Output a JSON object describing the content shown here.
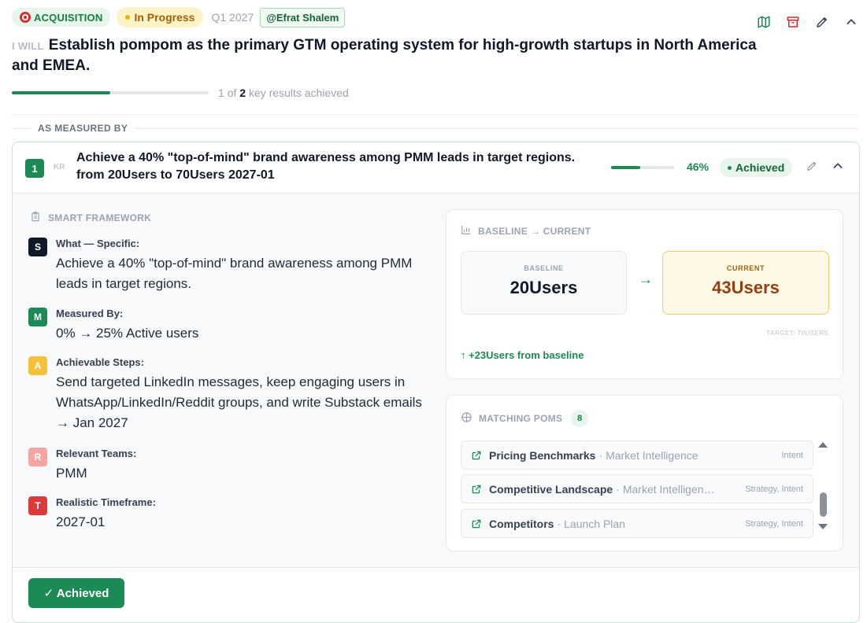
{
  "header": {
    "category": "ACQUISITION",
    "status": "In Progress",
    "quarter": "Q1 2027",
    "owner": "@Efrat Shalem"
  },
  "objective": {
    "prefix": "I WILL",
    "title": "Establish pompom as the primary GTM operating system for high-growth startups in North America and EMEA.",
    "progress_fraction": 0.5,
    "progress_achieved": "1",
    "progress_of": "of",
    "progress_total": "2",
    "progress_suffix": "key results achieved"
  },
  "section_label": "AS MEASURED BY",
  "key_result": {
    "number": "1",
    "tag": "KR",
    "title": "Achieve a 40% \"top-of-mind\" brand awareness among PMM leads in target regions. from 20Users to 70Users 2027-01",
    "progress_fraction": 0.46,
    "percent": "46%",
    "status": "Achieved",
    "smart": {
      "heading": "SMART FRAMEWORK",
      "items": [
        {
          "letter": "S",
          "label": "What — Specific:",
          "value": "Achieve a 40% \"top-of-mind\" brand awareness among PMM leads in target regions.",
          "color": "#111827"
        },
        {
          "letter": "M",
          "label": "Measured By:",
          "value": "0% → 25% Active users",
          "color": "#1b8a55"
        },
        {
          "letter": "A",
          "label": "Achievable Steps:",
          "value": "Send targeted LinkedIn messages, keep engaging users in WhatsApp/LinkedIn/Reddit groups, and write Substack emails → Jan 2027",
          "color": "#f5c13a"
        },
        {
          "letter": "R",
          "label": "Relevant Teams:",
          "value": "PMM",
          "color": "#f4a7a0"
        },
        {
          "letter": "T",
          "label": "Realistic Timeframe:",
          "value": "2027-01",
          "color": "#dc3a3a"
        }
      ]
    },
    "baseline_panel": {
      "heading": "BASELINE → CURRENT",
      "baseline_label": "BASELINE",
      "baseline_value": "20Users",
      "current_label": "CURRENT",
      "current_value": "43Users",
      "arrow": "→",
      "target": "TARGET: 70USERS",
      "delta": "↑ +23Users from baseline"
    },
    "poms_panel": {
      "heading": "MATCHING POMS",
      "count": "8",
      "items": [
        {
          "name": "Pricing Benchmarks",
          "sep": "·",
          "sub": "Market Intelligence",
          "tags": "Intent"
        },
        {
          "name": "Competitive Landscape",
          "sep": "·",
          "sub": "Market Intelligen…",
          "tags": "Strategy, Intent"
        },
        {
          "name": "Competitors",
          "sep": "·",
          "sub": "Launch Plan",
          "tags": "Strategy, Intent"
        }
      ]
    },
    "achieved_button": "✓ Achieved"
  },
  "colors": {
    "accent": "#1b8a55",
    "warning": "#eab308",
    "danger": "#dc2626"
  }
}
